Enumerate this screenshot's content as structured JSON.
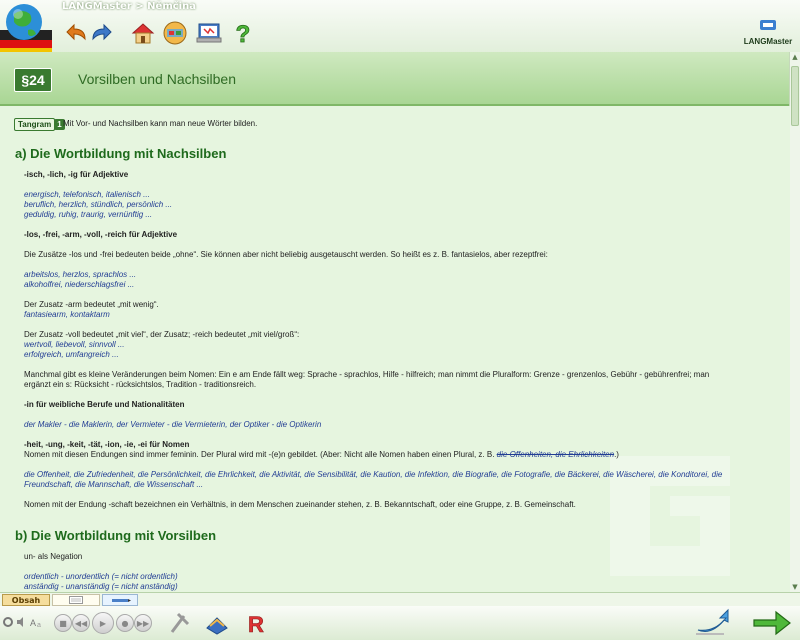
{
  "window": {
    "title": "LANGMaster > Němčina"
  },
  "brand": {
    "name": "LANGMaster"
  },
  "lesson": {
    "number": "§24",
    "title": "Vorsilben und Nachsilben"
  },
  "tag": {
    "label": "Tangram",
    "number": "1",
    "text": "Mit Vor- und Nachsilben kann man neue Wörter bilden."
  },
  "sections": {
    "a_title": "a) Die Wortbildung mit Nachsilben",
    "b_title": "b) Die Wortbildung mit Vorsilben"
  },
  "body": {
    "l1": "-isch, -lich, -ig für Adjektive",
    "l2": "energisch, telefonisch, italienisch ...",
    "l3": "beruflich, herzlich, stündlich, persönlich ...",
    "l4": "geduldig, ruhig, traurig, vernünftig ...",
    "l5": "-los, -frei, -arm, -voll, -reich für Adjektive",
    "l6": "Die Zusätze -los und -frei bedeuten beide „ohne“. Sie können aber nicht beliebig ausgetauscht werden. So heißt es z. B. fantasielos, aber rezeptfrei:",
    "l7": "arbeitslos, herzlos, sprachlos ...",
    "l8": "alkoholfrei, niederschlagsfrei ...",
    "l9": "Der Zusatz -arm bedeutet „mit wenig“.",
    "l10": "fantasiearm, kontaktarm",
    "l11": "Der Zusatz -voll bedeutet „mit viel“, der Zusatz; -reich bedeutet „mit viel/groß“:",
    "l12": "wertvoll, liebevoll, sinnvoll ...",
    "l13": "erfolgreich, umfangreich ...",
    "l14": "Manchmal gibt es kleine Veränderungen beim Nomen: Ein e am Ende fällt weg: Sprache - sprachlos, Hilfe - hilfreich; man nimmt die Pluralform: Grenze - grenzenlos, Gebühr - gebührenfrei; man",
    "l15": "ergänzt ein s: Rücksicht - rücksichtslos, Tradition - traditionsreich.",
    "l16": "-in für weibliche Berufe und Nationalitäten",
    "l17": "der Makler - die Maklerin, der Vermieter - die Vermieterin, der Optiker - die Optikerin",
    "l18": "-heit, -ung, -keit, -tät, -ion, -ie, -ei für Nomen",
    "l19": "Nomen mit diesen Endungen sind immer feminin. Der Plural wird mit -(e)n gebildet. (Aber: Nicht alle Nomen haben einen Plural, z. B.",
    "l19s": "die Offenheiten, die Ehrlichkeiten",
    "l19e": ".)",
    "l20": "die Offenheit, die Zufriedenheit, die Persönlichkeit, die Ehrlichkeit, die Aktivität, die Sensibilität, die Kaution, die Infektion, die Biografie, die Fotografie, die Bäckerei, die Wäscherei, die Konditorei, die",
    "l21": "Freundschaft, die Mannschaft, die Wissenschaft ...",
    "l22": "Nomen mit der Endung -schaft bezeichnen ein Verhältnis, in dem Menschen zueinander stehen, z. B. Bekanntschaft, oder eine Gruppe, z. B. Gemeinschaft.",
    "l23": "un- als Negation",
    "l24": "ordentlich - unordentlich (= nicht ordentlich)",
    "l25": "anständig - unanständig (= nicht anständig)"
  },
  "status": {
    "tab1": "Obsah"
  },
  "colors": {
    "accent": "#1e6a1c",
    "example": "#223d94",
    "header": "#a9d694"
  }
}
